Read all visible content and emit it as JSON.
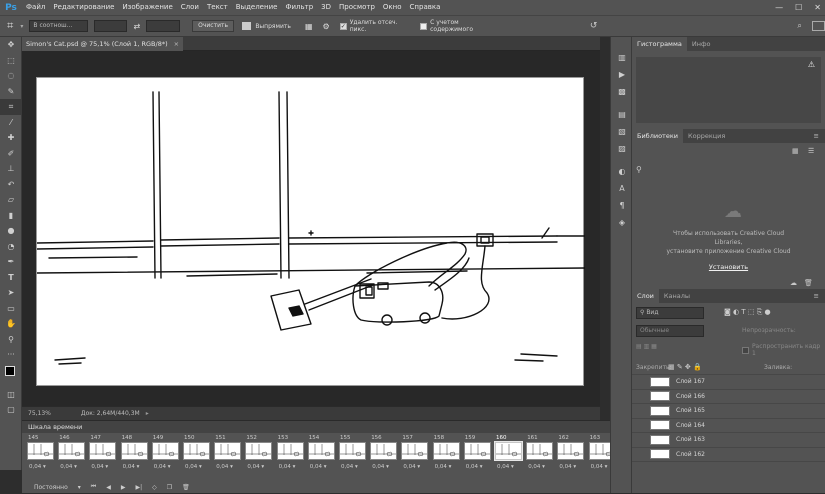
{
  "app": {
    "logo": "Ps"
  },
  "menu": [
    "Файл",
    "Редактирование",
    "Изображение",
    "Слои",
    "Текст",
    "Выделение",
    "Фильтр",
    "3D",
    "Просмотр",
    "Окно",
    "Справка"
  ],
  "window_controls": [
    "—",
    "☐",
    "✕"
  ],
  "options_bar": {
    "ratio_value": "В соотнош...",
    "clear_label": "Очистить",
    "straighten_label": "Выпрямить",
    "delete_cropped_label": "Удалить отсеч. пикс.",
    "delete_cropped_checked": true,
    "content_aware_label": "С учетом содержимого",
    "content_aware_checked": false
  },
  "document": {
    "tab_title": "Simon's Cat.psd @ 75,1% (Слой 1, RGB/8*)",
    "zoom": "75,13%",
    "doc_size": "Док: 2,64M/440,3M"
  },
  "timeline": {
    "title": "Шкала времени",
    "frames": [
      {
        "num": "145",
        "time": "0,04"
      },
      {
        "num": "146",
        "time": "0,04"
      },
      {
        "num": "147",
        "time": "0,04"
      },
      {
        "num": "148",
        "time": "0,04"
      },
      {
        "num": "149",
        "time": "0,04"
      },
      {
        "num": "150",
        "time": "0,04"
      },
      {
        "num": "151",
        "time": "0,04"
      },
      {
        "num": "152",
        "time": "0,04"
      },
      {
        "num": "153",
        "time": "0,04"
      },
      {
        "num": "154",
        "time": "0,04"
      },
      {
        "num": "155",
        "time": "0,04"
      },
      {
        "num": "156",
        "time": "0,04"
      },
      {
        "num": "157",
        "time": "0,04"
      },
      {
        "num": "158",
        "time": "0,04"
      },
      {
        "num": "159",
        "time": "0,04"
      },
      {
        "num": "160",
        "time": "0,04",
        "selected": true
      },
      {
        "num": "161",
        "time": "0,04"
      },
      {
        "num": "162",
        "time": "0,04"
      },
      {
        "num": "163",
        "time": "0,04"
      }
    ],
    "loop_label": "Постоянно"
  },
  "panels": {
    "histogram_tabs": [
      "Гистограмма",
      "Инфо"
    ],
    "libraries_tabs": [
      "Библиотеки",
      "Коррекция"
    ],
    "libraries_message": [
      "Чтобы использовать Creative Cloud",
      "Libraries,",
      "установите приложение Creative Cloud"
    ],
    "install_label": "Установить",
    "layers_tabs": [
      "Слои",
      "Каналы"
    ],
    "layer_filter": "Вид",
    "blend_mode": "Обычные",
    "opacity_label": "Непрозрачность:",
    "lock_label": "Закрепить:",
    "fill_label": "Заливка:",
    "propagate_label": "Распространить кадр 1",
    "layers": [
      "Слой 167",
      "Слой 166",
      "Слой 165",
      "Слой 164",
      "Слой 163",
      "Слой 162"
    ]
  }
}
